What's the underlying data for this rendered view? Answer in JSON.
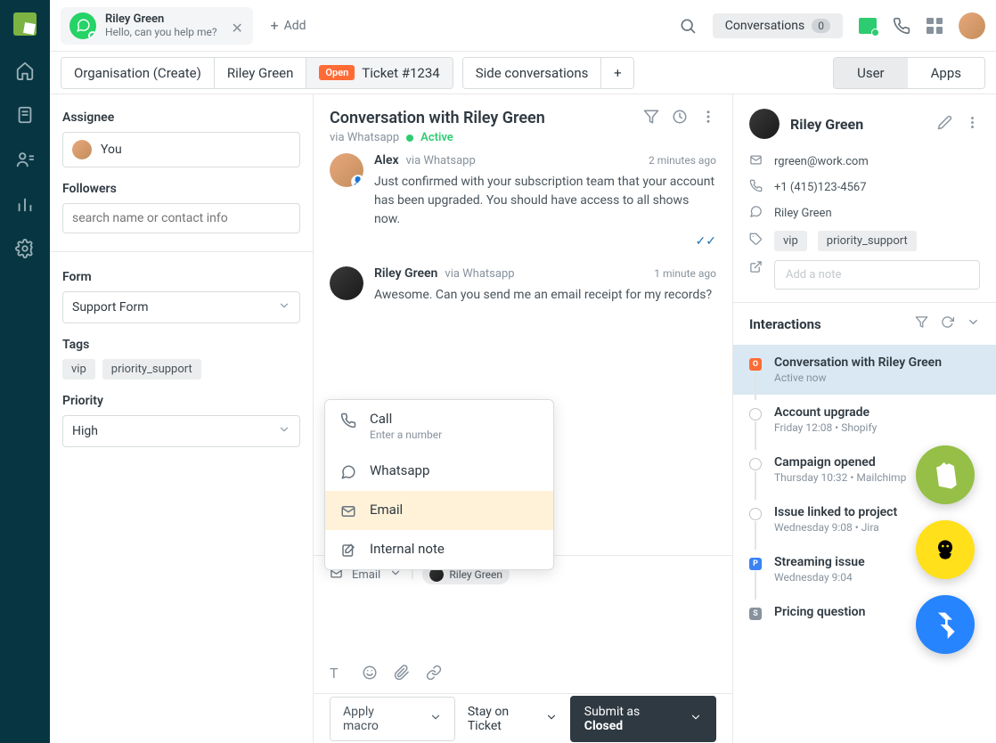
{
  "topbar": {
    "tab_contact": "Riley Green",
    "tab_preview": "Hello, can you help me?",
    "add_label": "Add",
    "conversations_label": "Conversations",
    "conversations_count": "0"
  },
  "tabs": {
    "org": "Organisation (Create)",
    "person": "Riley Green",
    "open_badge": "Open",
    "ticket": "Ticket #1234",
    "side": "Side conversations",
    "toggle_user": "User",
    "toggle_apps": "Apps"
  },
  "left": {
    "assignee_lbl": "Assignee",
    "assignee_val": "You",
    "followers_lbl": "Followers",
    "followers_ph": "search name or contact info",
    "form_lbl": "Form",
    "form_val": "Support Form",
    "tags_lbl": "Tags",
    "tag1": "vip",
    "tag2": "priority_support",
    "priority_lbl": "Priority",
    "priority_val": "High"
  },
  "conv": {
    "title": "Conversation with Riley Green",
    "via": "via Whatsapp",
    "status": "Active",
    "m1_name": "Alex",
    "m1_via": "via Whatsapp",
    "m1_time": "2 minutes ago",
    "m1_txt": "Just confirmed with your subscription team that your account has been upgraded. You should have access to all shows now.",
    "m2_name": "Riley Green",
    "m2_via": "via Whatsapp",
    "m2_time": "1 minute ago",
    "m2_txt": "Awesome. Can you send me an email receipt for my records?"
  },
  "menu": {
    "call": "Call",
    "call_sub": "Enter a number",
    "wa": "Whatsapp",
    "email": "Email",
    "note": "Internal note"
  },
  "composer": {
    "channel": "Email",
    "recipient": "Riley Green"
  },
  "footer": {
    "macro": "Apply macro",
    "stay": "Stay on Ticket",
    "submit_pre": "Submit as ",
    "submit_state": "Closed"
  },
  "right": {
    "name": "Riley Green",
    "email": "rgreen@work.com",
    "phone": "+1 (415)123-4567",
    "wa": "Riley Green",
    "tag1": "vip",
    "tag2": "priority_support",
    "note_ph": "Add a note",
    "inter_lbl": "Interactions",
    "i1_t": "Conversation with Riley Green",
    "i1_s": "Active now",
    "i2_t": "Account upgrade",
    "i2_s": "Friday 12:08 • Shopify",
    "i3_t": "Campaign opened",
    "i3_s": "Thursday 10:32 • Mailchimp",
    "i4_t": "Issue linked to project",
    "i4_s": "Wednesday 9:08 • Jira",
    "i5_t": "Streaming issue",
    "i5_s": "Wednesday 9:04",
    "i6_t": "Pricing question"
  }
}
